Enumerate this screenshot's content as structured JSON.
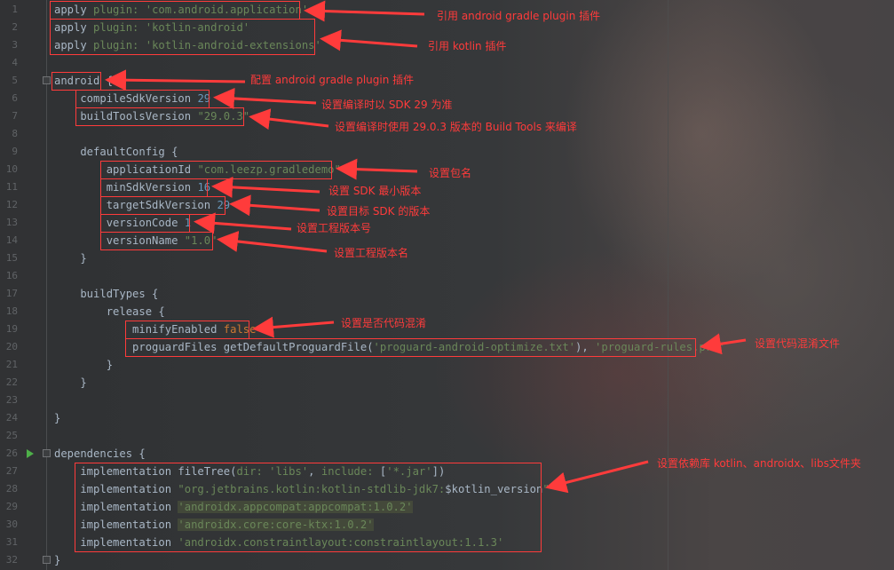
{
  "editor": {
    "lines": [
      {
        "n": "1",
        "parts": [
          [
            "apply ",
            ""
          ],
          [
            "plugin: ",
            "k-str"
          ],
          [
            "'com.android.application'",
            "k-str"
          ]
        ]
      },
      {
        "n": "2",
        "parts": [
          [
            "apply ",
            ""
          ],
          [
            "plugin: ",
            "k-str"
          ],
          [
            "'kotlin-android'",
            "k-str"
          ]
        ]
      },
      {
        "n": "3",
        "parts": [
          [
            "apply ",
            ""
          ],
          [
            "plugin: ",
            "k-str"
          ],
          [
            "'kotlin-android-extensions'",
            "k-str"
          ]
        ]
      },
      {
        "n": "4",
        "parts": []
      },
      {
        "n": "5",
        "parts": [
          [
            "android {",
            ""
          ]
        ]
      },
      {
        "n": "6",
        "parts": [
          [
            "    compileSdkVersion ",
            ""
          ],
          [
            "29",
            "k-num"
          ]
        ]
      },
      {
        "n": "7",
        "parts": [
          [
            "    buildToolsVersion ",
            ""
          ],
          [
            "\"29.0.3\"",
            "k-str"
          ]
        ]
      },
      {
        "n": "8",
        "parts": []
      },
      {
        "n": "9",
        "parts": [
          [
            "    defaultConfig {",
            ""
          ]
        ]
      },
      {
        "n": "10",
        "parts": [
          [
            "        applicationId ",
            ""
          ],
          [
            "\"com.leezp.gradledemo\"",
            "k-str"
          ]
        ]
      },
      {
        "n": "11",
        "parts": [
          [
            "        minSdkVersion ",
            ""
          ],
          [
            "16",
            "k-num"
          ]
        ]
      },
      {
        "n": "12",
        "parts": [
          [
            "        targetSdkVersion ",
            ""
          ],
          [
            "29",
            "k-num"
          ]
        ]
      },
      {
        "n": "13",
        "parts": [
          [
            "        versionCode ",
            ""
          ],
          [
            "1",
            "k-num"
          ]
        ]
      },
      {
        "n": "14",
        "parts": [
          [
            "        versionName ",
            ""
          ],
          [
            "\"1.0\"",
            "k-str"
          ]
        ]
      },
      {
        "n": "15",
        "parts": [
          [
            "    }",
            ""
          ]
        ]
      },
      {
        "n": "16",
        "parts": []
      },
      {
        "n": "17",
        "parts": [
          [
            "    buildTypes {",
            ""
          ]
        ]
      },
      {
        "n": "18",
        "parts": [
          [
            "        release {",
            ""
          ]
        ]
      },
      {
        "n": "19",
        "parts": [
          [
            "            minifyEnabled ",
            ""
          ],
          [
            "false",
            "k-kw"
          ]
        ]
      },
      {
        "n": "20",
        "parts": [
          [
            "            proguardFiles getDefaultProguardFile(",
            ""
          ],
          [
            "'proguard-android-optimize.txt'",
            "k-str"
          ],
          [
            "), ",
            ""
          ],
          [
            "'proguard-rules.pro'",
            "k-str"
          ]
        ]
      },
      {
        "n": "21",
        "parts": [
          [
            "        }",
            ""
          ]
        ]
      },
      {
        "n": "22",
        "parts": [
          [
            "    }",
            ""
          ]
        ]
      },
      {
        "n": "23",
        "parts": []
      },
      {
        "n": "24",
        "parts": [
          [
            "}",
            ""
          ]
        ]
      },
      {
        "n": "25",
        "parts": []
      },
      {
        "n": "26",
        "parts": [
          [
            "dependencies {",
            ""
          ]
        ]
      },
      {
        "n": "27",
        "parts": [
          [
            "    implementation fileTree(",
            ""
          ],
          [
            "dir: ",
            "k-str"
          ],
          [
            "'libs'",
            "k-str"
          ],
          [
            ", ",
            ""
          ],
          [
            "include: ",
            "k-str"
          ],
          [
            "[",
            ""
          ],
          [
            "'*.jar'",
            "k-str"
          ],
          [
            "])",
            ""
          ]
        ]
      },
      {
        "n": "28",
        "parts": [
          [
            "    implementation ",
            ""
          ],
          [
            "\"org.jetbrains.kotlin:kotlin-stdlib-jdk7:",
            "k-str"
          ],
          [
            "$kotlin_version",
            ""
          ],
          [
            "\"",
            "k-str"
          ]
        ]
      },
      {
        "n": "29",
        "parts": [
          [
            "    implementation ",
            ""
          ],
          [
            "'androidx.appcompat:appcompat:1.0.2'",
            "k-str k-hl"
          ]
        ]
      },
      {
        "n": "30",
        "parts": [
          [
            "    implementation ",
            ""
          ],
          [
            "'androidx.core:core-ktx:1.0.2'",
            "k-str k-hl"
          ]
        ]
      },
      {
        "n": "31",
        "parts": [
          [
            "    implementation ",
            ""
          ],
          [
            "'androidx.constraintlayout:constraintlayout:1.1.3'",
            "k-str"
          ]
        ]
      },
      {
        "n": "32",
        "parts": [
          [
            "}",
            ""
          ]
        ]
      }
    ]
  },
  "annotations": {
    "a1": "引用 android gradle plugin 插件",
    "a2": "引用 kotlin 插件",
    "a3": "配置 android gradle plugin 插件",
    "a4": "设置编译时以 SDK 29 为准",
    "a5": "设置编译时使用 29.0.3 版本的 Build Tools 来编译",
    "a6": "设置包名",
    "a7": "设置 SDK 最小版本",
    "a8": "设置目标 SDK 的版本",
    "a9": "设置工程版本号",
    "a10": "设置工程版本名",
    "a11": "设置是否代码混淆",
    "a12": "设置代码混淆文件",
    "a13": "设置依赖库 kotlin、androidx、libs文件夹"
  },
  "colors": {
    "annotation": "#ff3b3b",
    "string": "#6a8759",
    "number": "#6897bb",
    "keyword": "#cc7832",
    "text": "#a9b7c6"
  }
}
